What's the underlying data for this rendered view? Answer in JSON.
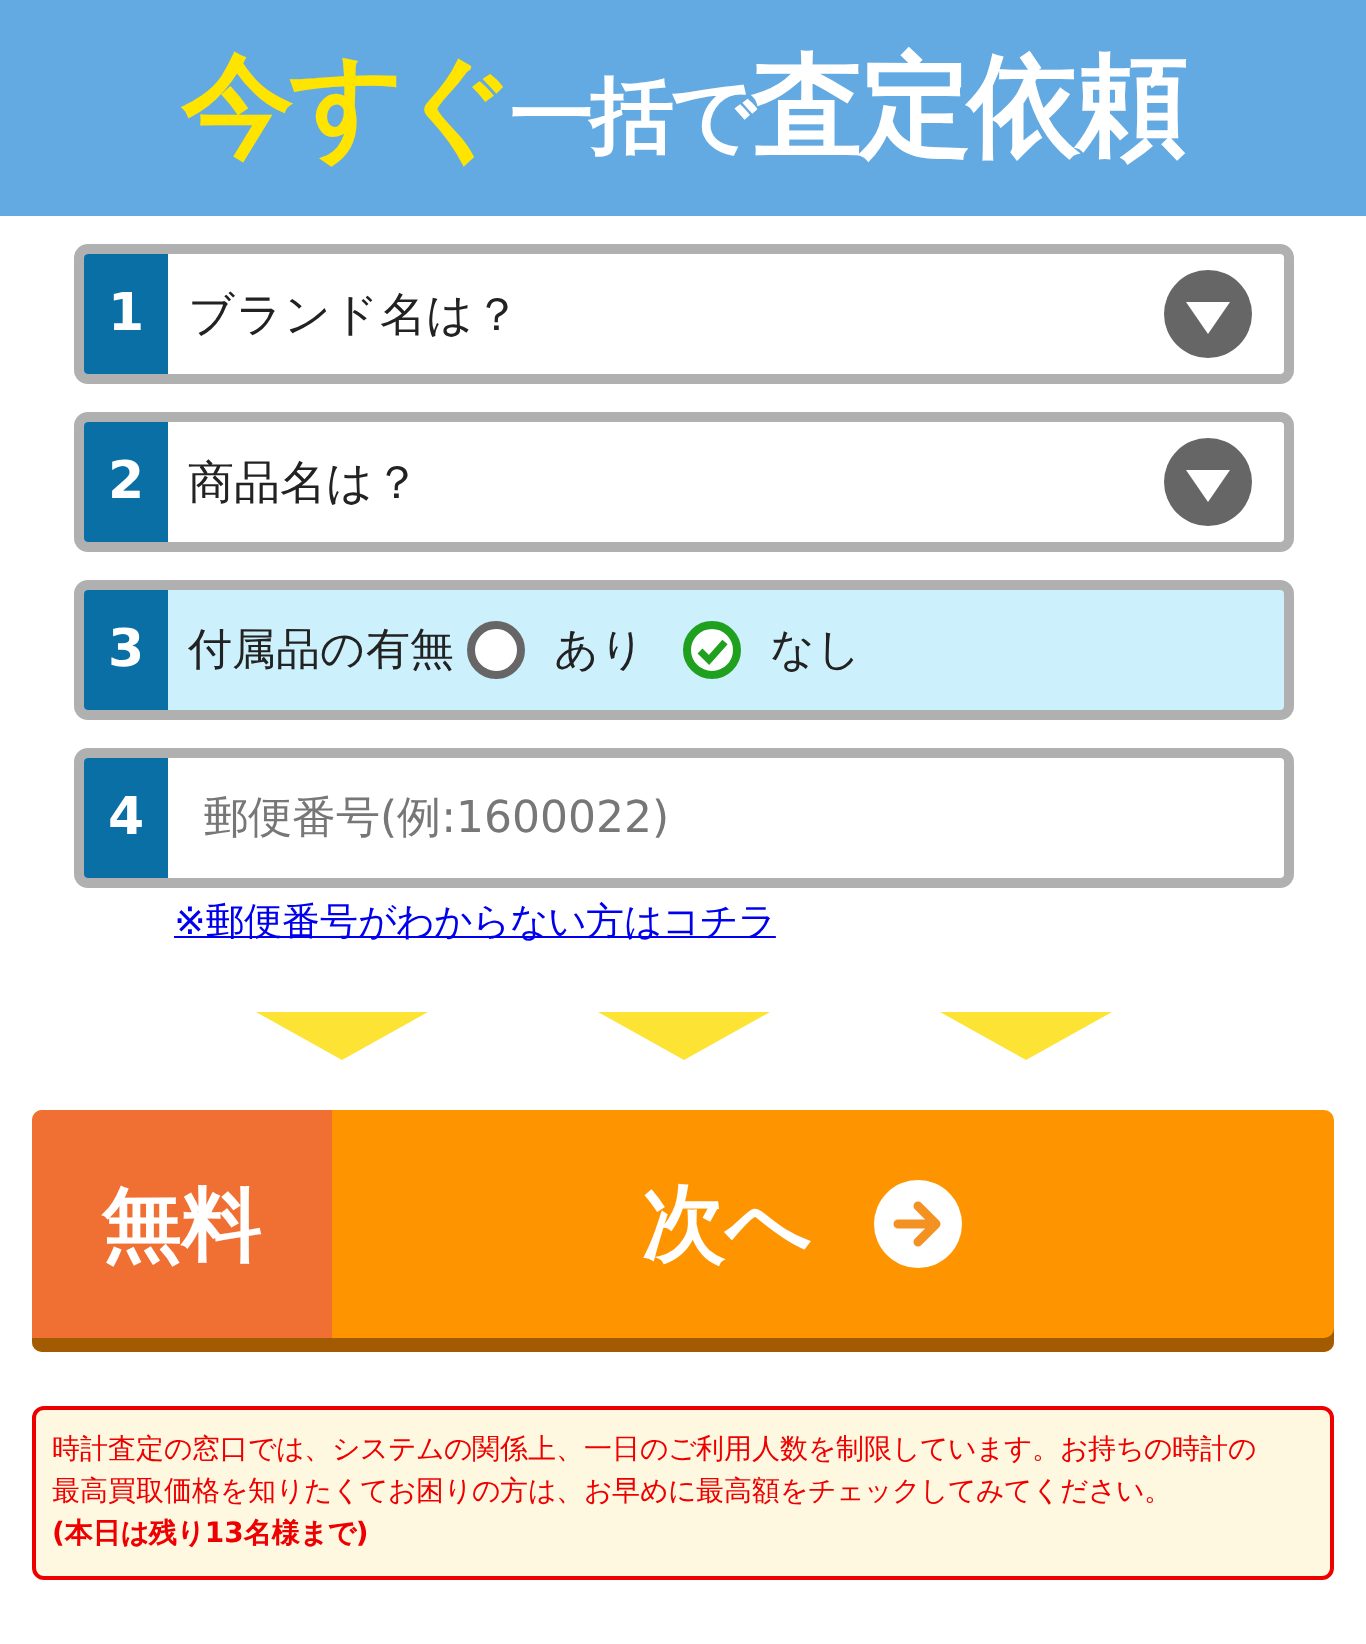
{
  "header": {
    "title_parts": [
      {
        "text": "今すぐ",
        "kind": "accent"
      },
      {
        "text": "一括で",
        "kind": "small"
      },
      {
        "text": "査定依頼",
        "kind": "large"
      }
    ]
  },
  "steps": [
    {
      "number": "1",
      "kind": "select",
      "label": "ブランド名は？"
    },
    {
      "number": "2",
      "kind": "select",
      "label": "商品名は？"
    },
    {
      "number": "3",
      "kind": "radio",
      "label": "付属品の有無",
      "options": [
        {
          "label": "あり",
          "selected": false
        },
        {
          "label": "なし",
          "selected": true
        }
      ]
    },
    {
      "number": "4",
      "kind": "input",
      "placeholder": "郵便番号(例:1600022)"
    }
  ],
  "postal_link": "※郵便番号がわからない方はコチラ",
  "submit": {
    "badge": "無料",
    "label": "次へ"
  },
  "notice": "時計査定の窓口では、システムの関係上、一日のご利用人数を制限しています。お持ちの時計の最高買取価格を知りたくてお困りの方は、お早めに最高額をチェックしてみてください。\n**(本日は残り13名様まで)**"
}
